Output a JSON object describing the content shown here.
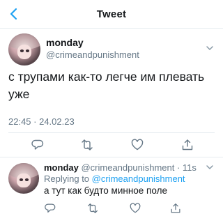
{
  "header": {
    "title": "Tweet",
    "back_icon": "back-arrow-icon",
    "accent": "#1da1f2"
  },
  "tweet": {
    "name": "monday",
    "handle": "@crimeandpunishment",
    "text": "с трупами как-то легче им плевать уже",
    "timestamp": "22:45 · 24.02.23",
    "actions": [
      "reply-icon",
      "retweet-icon",
      "like-icon",
      "share-icon"
    ]
  },
  "reply": {
    "name": "monday",
    "handle": "@crimeandpunishment",
    "time": "· 11s",
    "replying_prefix": "Replying to",
    "replying_to": "@crimeandpunishment",
    "text": "а тут как будто минное поле",
    "actions": [
      "reply-icon",
      "retweet-icon",
      "like-icon",
      "share-icon"
    ]
  }
}
